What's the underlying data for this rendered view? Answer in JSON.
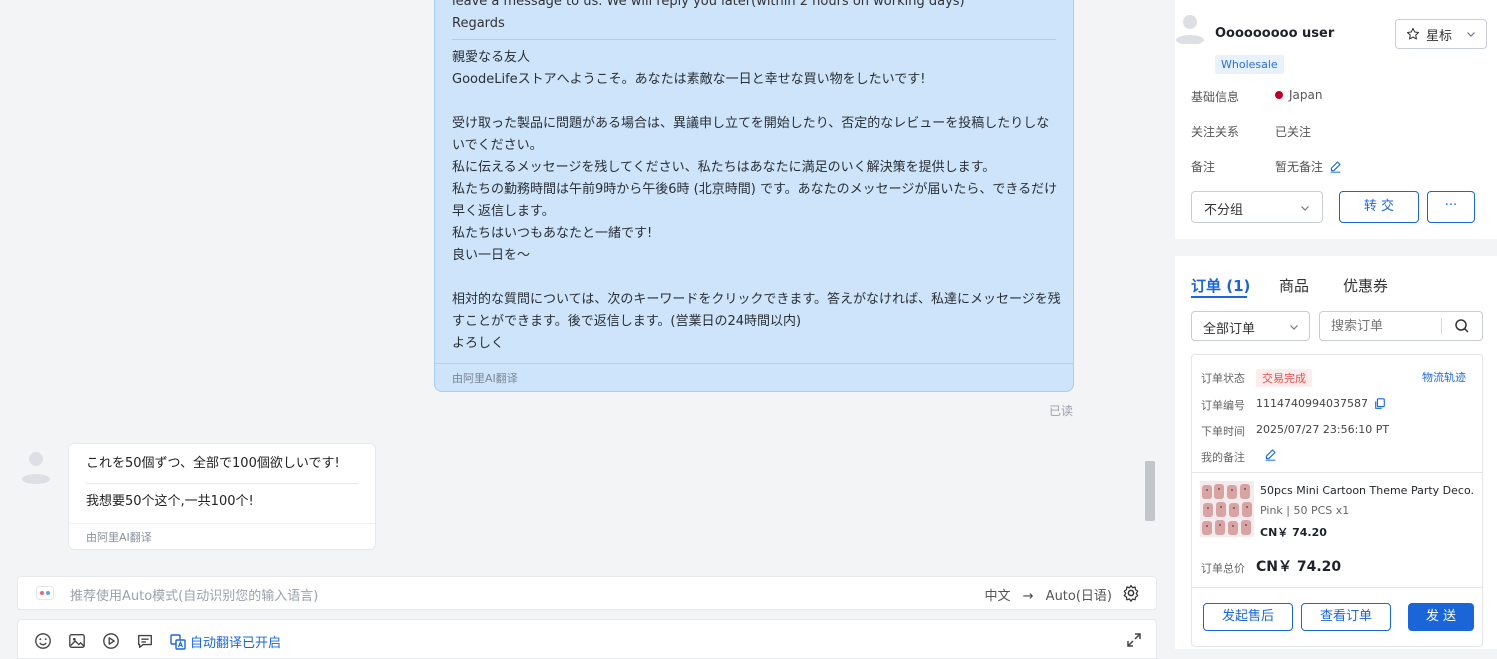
{
  "chat": {
    "own_message": {
      "original_lines": [
        "leave a message to us. We will reply you later(within 2 hours on working days)",
        "Regards"
      ],
      "translation": "親愛なる友人\nGoodeLifeストアへようこそ。あなたは素敵な一日と幸せな買い物をしたいです!\n\n受け取った製品に問題がある場合は、異議申し立てを開始したり、否定的なレビューを投稿したりしないでください。\n私に伝えるメッセージを残してください、私たちはあなたに満足のいく解決策を提供します。\n私たちの勤務時間は午前9時から午後6時 (北京時間) です。あなたのメッセージが届いたら、できるだけ早く返信します。\n私たちはいつもあなたと一緒です!\n良い一日を〜\n\n相対的な質問については、次のキーワードをクリックできます。答えがなければ、私達にメッセージを残すことができます。後で返信します。(営業日の24時間以内)\nよろしく",
      "footer": "由阿里AI翻译",
      "status": "已读"
    },
    "incoming_message": {
      "original": "これを50個ずつ、全部で100個欲しいです!",
      "translation": "我想要50个这个,一共100个!",
      "footer": "由阿里AI翻译"
    },
    "translate_bar": {
      "placeholder": "推荐使用Auto模式(自动识别您的输入语言)",
      "source_lang": "中文",
      "arrow": "→",
      "target_lang": "Auto(日语)"
    },
    "toolbar": {
      "auto_translate_label": "自动翻译已开启",
      "icons": [
        "emoji-icon",
        "image-icon",
        "video-icon",
        "quick-reply-icon",
        "translate-icon",
        "expand-icon"
      ]
    }
  },
  "customer": {
    "name": "Ooooooooo user",
    "star_label": "星标",
    "tag": "Wholesale",
    "basic_info_label": "基础信息",
    "country": "Japan",
    "follow_label": "关注关系",
    "follow_value": "已关注",
    "note_label": "备注",
    "note_value": "暂无备注",
    "group_select": "不分组",
    "transfer_label": "转 交",
    "more_label": "···"
  },
  "orders": {
    "tabs": [
      {
        "label": "订单 (1)",
        "active": true
      },
      {
        "label": "商品",
        "active": false
      },
      {
        "label": "优惠券",
        "active": false
      }
    ],
    "filter": "全部订单",
    "search_placeholder": "搜索订单",
    "card": {
      "status_label": "订单状态",
      "status_value": "交易完成",
      "logistics_label": "物流轨迹",
      "number_label": "订单编号",
      "number_value": "1114740994037587",
      "time_label": "下单时间",
      "time_value": "2025/07/27 23:56:10 PT",
      "my_note_label": "我的备注",
      "product_title": "50pcs Mini Cartoon Theme Party Deco...",
      "product_spec": "Pink | 50 PCS x1",
      "product_price": "CN￥ 74.20",
      "total_label": "订单总价",
      "total_value": "CN￥ 74.20"
    },
    "buttons": {
      "after_sale": "发起售后",
      "view_order": "查看订单",
      "send": "发 送"
    }
  },
  "colors": {
    "accent": "#1a66d9",
    "own_bubble": "#cde4fb",
    "status_red": "#e34d4d",
    "tag_bg": "#e8f1fe"
  }
}
